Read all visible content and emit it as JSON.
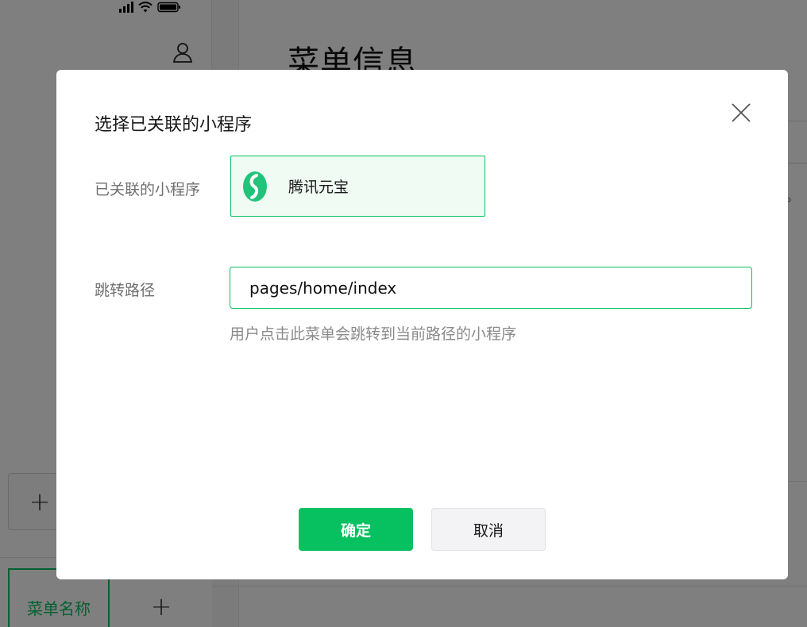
{
  "background": {
    "page_title": "菜单信息",
    "menu_tab_label": "菜单名称",
    "add_symbol": "+",
    "dot": "。"
  },
  "dialog": {
    "title": "选择已关联的小程序",
    "linked_label": "已关联的小程序",
    "selected_miniprogram": {
      "name": "腾讯元宝",
      "icon": "yuanbao-logo-icon"
    },
    "path_label": "跳转路径",
    "path_value": "pages/home/index",
    "hint": "用户点击此菜单会跳转到当前路径的小程序",
    "confirm_label": "确定",
    "cancel_label": "取消"
  },
  "colors": {
    "accent": "#07c160",
    "card_bg": "#f0fbf4",
    "overlay": "rgba(0,0,0,0.5)"
  }
}
